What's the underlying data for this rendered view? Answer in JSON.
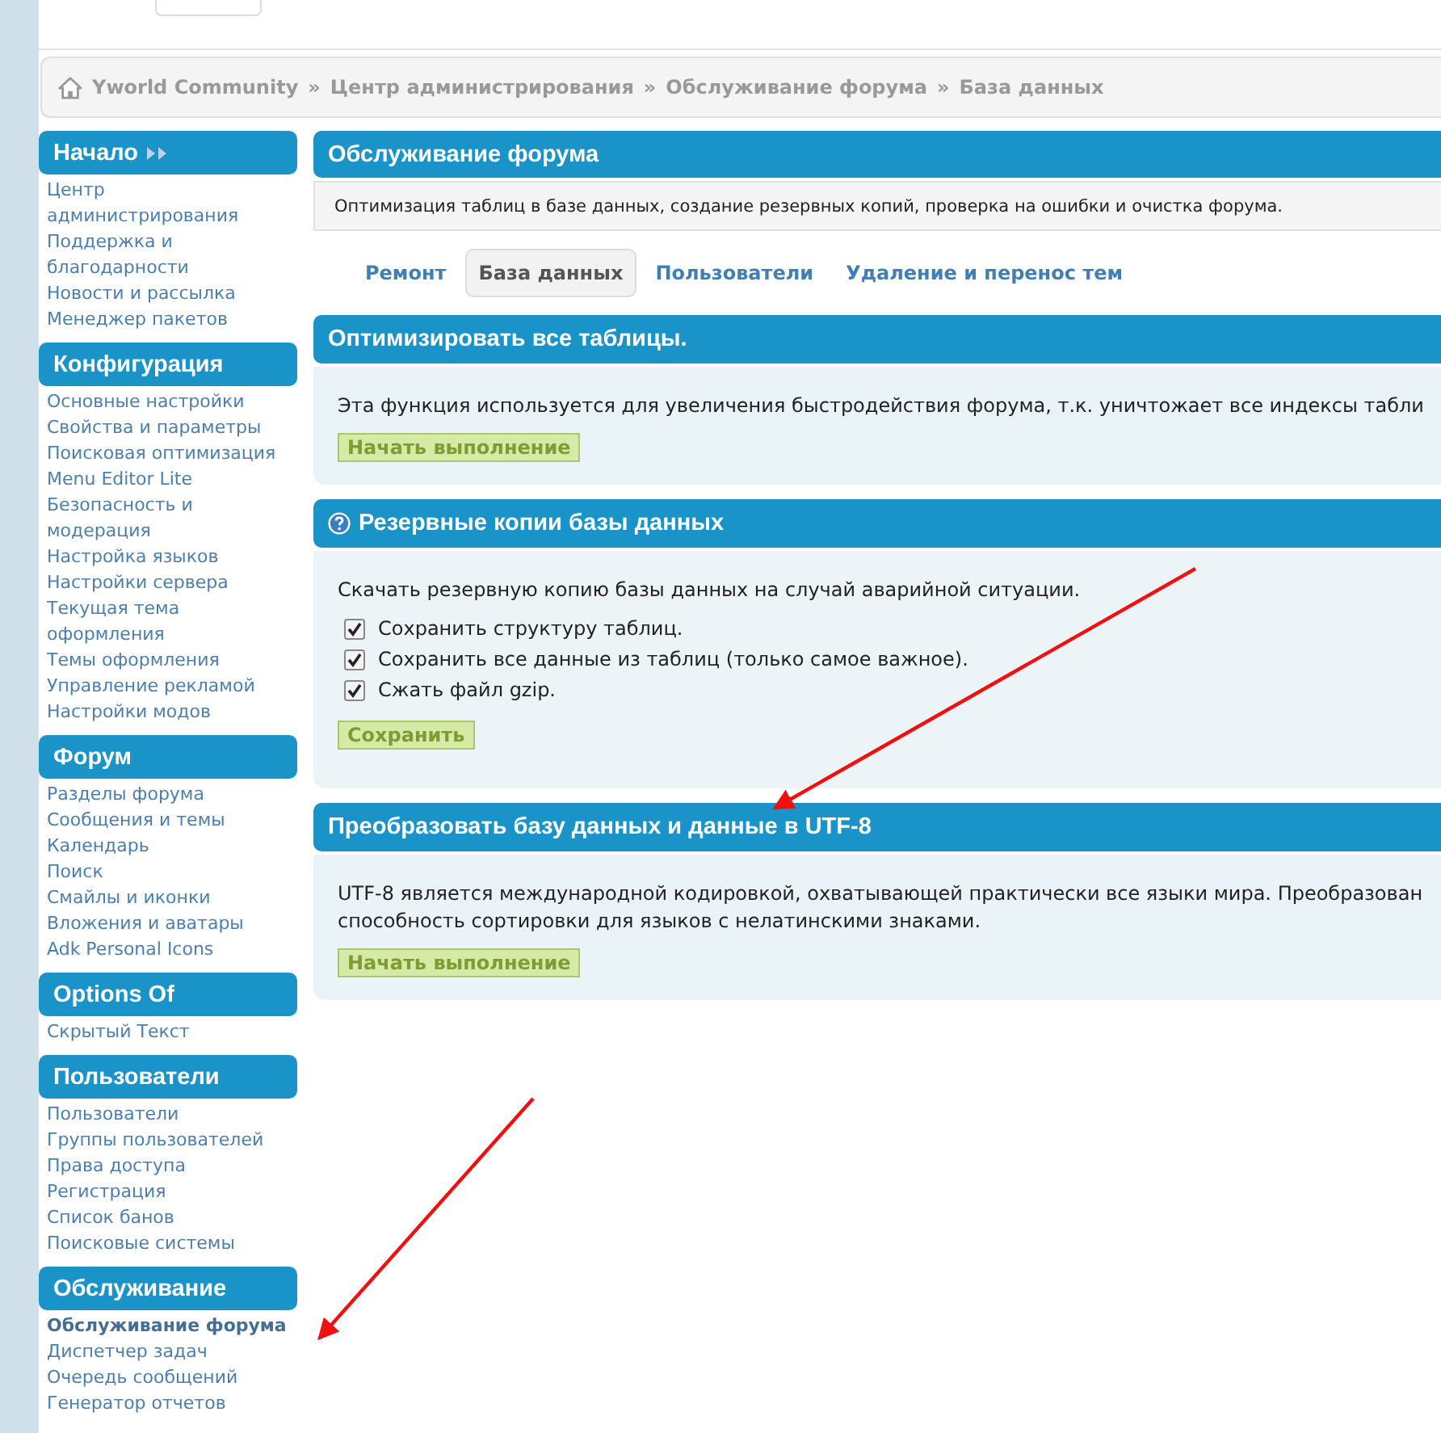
{
  "breadcrumb": {
    "separator": "»",
    "items": [
      "Yworld Community",
      "Центр администрирования",
      "Обслуживание форума",
      "База данных"
    ]
  },
  "sidebar": [
    {
      "title": "Начало",
      "expand_toggle": true,
      "items": [
        {
          "label": "Центр администрирования",
          "selected": false
        },
        {
          "label": "Поддержка и благодарности",
          "selected": false
        },
        {
          "label": "Новости и рассылка",
          "selected": false
        },
        {
          "label": "Менеджер пакетов",
          "selected": false
        }
      ]
    },
    {
      "title": "Конфигурация",
      "expand_toggle": false,
      "items": [
        {
          "label": "Основные настройки",
          "selected": false
        },
        {
          "label": "Свойства и параметры",
          "selected": false
        },
        {
          "label": "Поисковая оптимизация",
          "selected": false
        },
        {
          "label": "Menu Editor Lite",
          "selected": false
        },
        {
          "label": "Безопасность и модерация",
          "selected": false
        },
        {
          "label": "Настройка языков",
          "selected": false
        },
        {
          "label": "Настройки сервера",
          "selected": false
        },
        {
          "label": "Текущая тема оформления",
          "selected": false
        },
        {
          "label": "Темы оформления",
          "selected": false
        },
        {
          "label": "Управление рекламой",
          "selected": false
        },
        {
          "label": "Настройки модов",
          "selected": false
        }
      ]
    },
    {
      "title": "Форум",
      "expand_toggle": false,
      "items": [
        {
          "label": "Разделы форума",
          "selected": false
        },
        {
          "label": "Сообщения и темы",
          "selected": false
        },
        {
          "label": "Календарь",
          "selected": false
        },
        {
          "label": "Поиск",
          "selected": false
        },
        {
          "label": "Смайлы и иконки",
          "selected": false
        },
        {
          "label": "Вложения и аватары",
          "selected": false
        },
        {
          "label": "Adk Personal Icons",
          "selected": false
        }
      ]
    },
    {
      "title": "Options Of",
      "expand_toggle": false,
      "items": [
        {
          "label": "Скрытый Текст",
          "selected": false
        }
      ]
    },
    {
      "title": "Пользователи",
      "expand_toggle": false,
      "items": [
        {
          "label": "Пользователи",
          "selected": false
        },
        {
          "label": "Группы пользователей",
          "selected": false
        },
        {
          "label": "Права доступа",
          "selected": false
        },
        {
          "label": "Регистрация",
          "selected": false
        },
        {
          "label": "Список банов",
          "selected": false
        },
        {
          "label": "Поисковые системы",
          "selected": false
        }
      ]
    },
    {
      "title": "Обслуживание",
      "expand_toggle": false,
      "items": [
        {
          "label": "Обслуживание форума",
          "selected": true
        },
        {
          "label": "Диспетчер задач",
          "selected": false
        },
        {
          "label": "Очередь сообщений",
          "selected": false
        },
        {
          "label": "Генератор отчетов",
          "selected": false
        }
      ]
    }
  ],
  "main": {
    "title": "Обслуживание форума",
    "description": "Оптимизация таблиц в базе данных, создание резервных копий, проверка на ошибки и очистка форума.",
    "tabs": [
      {
        "label": "Ремонт",
        "selected": false
      },
      {
        "label": "База данных",
        "selected": true
      },
      {
        "label": "Пользователи",
        "selected": false
      },
      {
        "label": "Удаление и перенос тем",
        "selected": false
      }
    ],
    "sections": [
      {
        "title": "Оптимизировать все таблицы.",
        "help": false,
        "text_lines": [
          "Эта функция используется для увеличения быстродействия форума, т.к. уничтожает все индексы табли"
        ],
        "button": "Начать выполнение"
      },
      {
        "title": "Резервные копии базы данных",
        "help": true,
        "text_lines": [
          "Скачать резервную копию базы данных на случай аварийной ситуации."
        ],
        "checkboxes": [
          {
            "label": "Сохранить структуру таблиц.",
            "checked": true
          },
          {
            "label": "Сохранить все данные из таблиц (только самое важное).",
            "checked": true
          },
          {
            "label": "Сжать файл gzip.",
            "checked": true
          }
        ],
        "button": "Сохранить"
      },
      {
        "title": "Преобразовать базу данных и данные в UTF-8",
        "help": false,
        "text_lines": [
          "UTF-8 является международной кодировкой, охватывающей практически все языки мира. Преобразован",
          "способность сортировки для языков с нелатинскими знаками."
        ],
        "button": "Начать выполнение"
      }
    ]
  }
}
